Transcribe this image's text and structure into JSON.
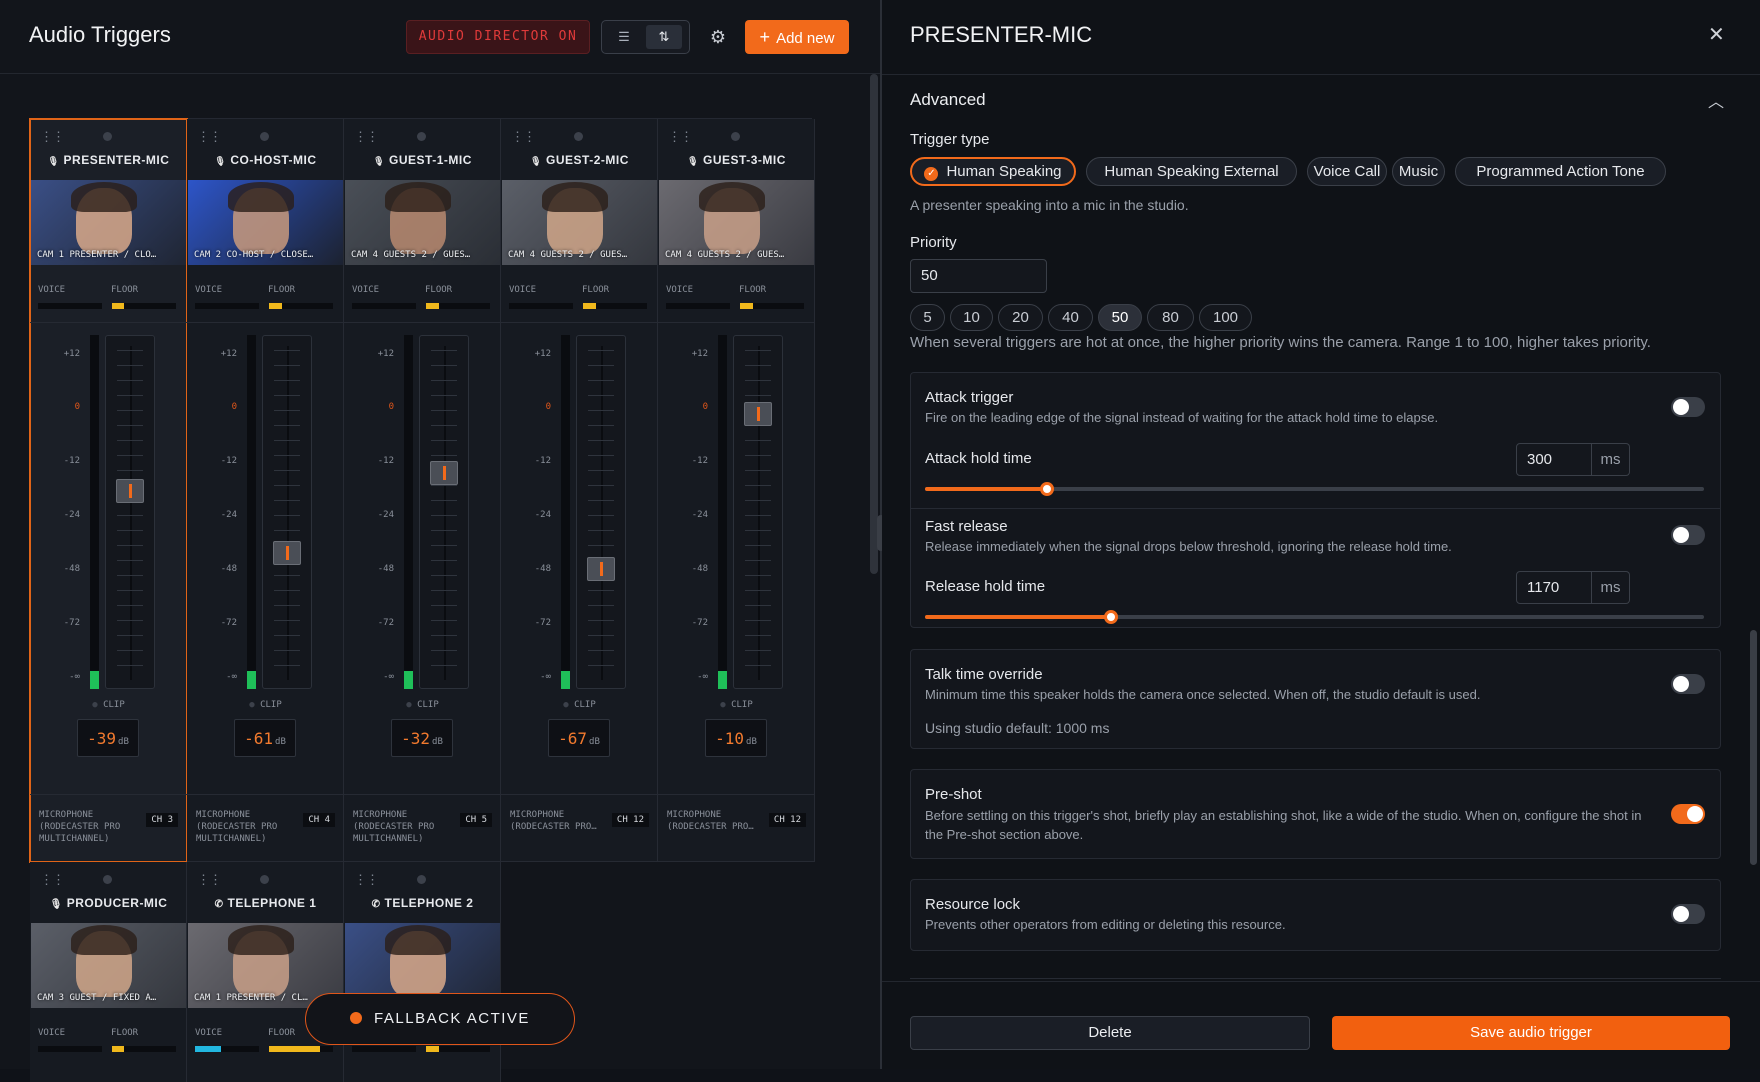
{
  "header": {
    "title": "Audio Triggers",
    "director_label": "AUDIO DIRECTOR ON",
    "list_view_icon": "list-icon",
    "mixer_view_icon": "sliders-icon",
    "settings_icon": "gear-icon",
    "add_button_icon": "plus-icon",
    "add_label": "Add new"
  },
  "strip_labels": {
    "voice": "VOICE",
    "floor": "FLOOR",
    "clip": "CLIP",
    "db_unit": "dB",
    "scale": [
      "+12",
      "0",
      "-12",
      "-24",
      "-48",
      "-72",
      "-∞"
    ]
  },
  "strips": [
    {
      "name": "PRESENTER-MIC",
      "icon": "microphone-icon",
      "caption": "CAM 1 PRESENTER / CLO…",
      "floor_level": 0.18,
      "meter_level": 0.05,
      "fader_position": 0.43,
      "db": "-39",
      "source": "MICROPHONE (RODECASTER PRO MULTICHANNEL)",
      "channel": "CH 3",
      "selected": true
    },
    {
      "name": "CO-HOST-MIC",
      "icon": "microphone-icon",
      "caption": "CAM 2 CO-HOST / CLOSE…",
      "floor_level": 0.2,
      "meter_level": 0.05,
      "fader_position": 0.63,
      "db": "-61",
      "source": "MICROPHONE (RODECASTER PRO MULTICHANNEL)",
      "channel": "CH 4",
      "selected": false
    },
    {
      "name": "GUEST-1-MIC",
      "icon": "microphone-icon",
      "caption": "CAM 4 GUESTS 2 / GUES…",
      "floor_level": 0.2,
      "meter_level": 0.05,
      "fader_position": 0.37,
      "db": "-32",
      "source": "MICROPHONE (RODECASTER PRO MULTICHANNEL)",
      "channel": "CH 5",
      "selected": false
    },
    {
      "name": "GUEST-2-MIC",
      "icon": "microphone-icon",
      "caption": "CAM 4 GUESTS 2 / GUES…",
      "floor_level": 0.2,
      "meter_level": 0.05,
      "fader_position": 0.68,
      "db": "-67",
      "source": "MICROPHONE (RODECASTER PRO…",
      "channel": "CH 12",
      "selected": false
    },
    {
      "name": "GUEST-3-MIC",
      "icon": "microphone-icon",
      "caption": "CAM 4 GUESTS 2 / GUES…",
      "floor_level": 0.2,
      "meter_level": 0.05,
      "fader_position": 0.18,
      "db": "-10",
      "source": "MICROPHONE (RODECASTER PRO…",
      "channel": "CH 12",
      "selected": false
    }
  ],
  "strips_row2": [
    {
      "name": "PRODUCER-MIC",
      "icon": "microphone-icon",
      "caption": "CAM 3 GUEST / FIXED A…",
      "voice_level": 0,
      "floor_level": 0.18
    },
    {
      "name": "TELEPHONE 1",
      "icon": "phone-icon",
      "caption": "CAM 1 PRESENTER / CL…",
      "voice_level": 0.4,
      "floor_level": 0.8
    },
    {
      "name": "TELEPHONE 2",
      "icon": "phone-icon",
      "caption": "",
      "voice_level": 0,
      "floor_level": 0.2
    }
  ],
  "fallback": {
    "label": "FALLBACK ACTIVE"
  },
  "panel": {
    "title": "PRESENTER-MIC",
    "close_icon": "close-icon",
    "section": "Advanced",
    "collapse_icon": "chevron-up-icon",
    "trigger_type_label": "Trigger type",
    "trigger_types": [
      "Human Speaking",
      "Human Speaking External",
      "Voice Call",
      "Music",
      "Programmed Action Tone"
    ],
    "trigger_type_selected": "Human Speaking",
    "trigger_type_desc": "A presenter speaking into a mic in the studio.",
    "priority_label": "Priority",
    "priority_value": "50",
    "priority_presets": [
      "5",
      "10",
      "20",
      "40",
      "50",
      "80",
      "100"
    ],
    "priority_help": "When several triggers are hot at once, the higher priority wins the camera. Range 1 to 100, higher takes priority.",
    "attack": {
      "title": "Attack trigger",
      "desc": "Fire on the leading edge of the signal instead of waiting for the attack hold time to elapse.",
      "enabled": false,
      "hold_label": "Attack hold time",
      "hold_value": "300",
      "unit": "ms",
      "slider_fraction": 0.157
    },
    "release": {
      "title": "Fast release",
      "desc": "Release immediately when the signal drops below threshold, ignoring the release hold time.",
      "enabled": false,
      "hold_label": "Release hold time",
      "hold_value": "1170",
      "unit": "ms",
      "slider_fraction": 0.239
    },
    "talk_time": {
      "title": "Talk time override",
      "desc": "Minimum time this speaker holds the camera once selected. When off, the studio default is used.",
      "enabled": false,
      "default_note": "Using studio default: 1000 ms"
    },
    "preshot": {
      "title": "Pre-shot",
      "desc": "Before settling on this trigger's shot, briefly play an establishing shot, like a wide of the studio. When on, configure the shot in the Pre-shot section above.",
      "enabled": true
    },
    "resource_lock": {
      "title": "Resource lock",
      "desc": "Prevents other operators from editing or deleting this resource.",
      "enabled": false
    },
    "delete_label": "Delete",
    "save_label": "Save audio trigger"
  }
}
